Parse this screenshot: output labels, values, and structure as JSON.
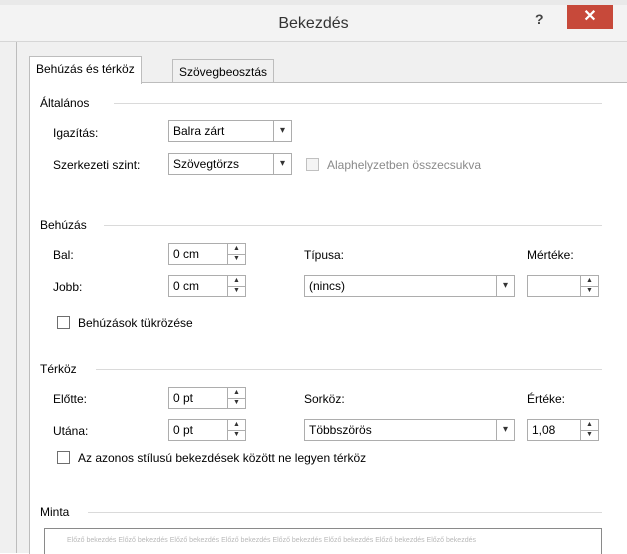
{
  "window": {
    "title": "Bekezdés",
    "help": "?",
    "close": "✕"
  },
  "tabs": [
    {
      "label": "Behúzás és térköz",
      "active": true
    },
    {
      "label": "Szövegbeosztás",
      "active": false
    }
  ],
  "general": {
    "legend": "Általános",
    "alignment_label": "Igazítás:",
    "alignment_value": "Balra zárt",
    "outline_label": "Szerkezeti szint:",
    "outline_value": "Szövegtörzs",
    "collapsed_label": "Alaphelyzetben összecsukva"
  },
  "indent": {
    "legend": "Behúzás",
    "left_label": "Bal:",
    "left_value": "0 cm",
    "right_label": "Jobb:",
    "right_value": "0 cm",
    "type_label": "Típusa:",
    "type_value": "(nincs)",
    "measure_label": "Mértéke:",
    "measure_value": "",
    "mirror_label": "Behúzások tükrözése"
  },
  "spacing": {
    "legend": "Térköz",
    "before_label": "Előtte:",
    "before_value": "0 pt",
    "after_label": "Utána:",
    "after_value": "0 pt",
    "line_label": "Sorköz:",
    "line_value": "Többszörös",
    "at_label": "Értéke:",
    "at_value": "1,08",
    "nospace_label": "Az azonos stílusú bekezdések között ne legyen térköz"
  },
  "preview": {
    "legend": "Minta",
    "text": "Előző bekezdés Előző bekezdés Előző bekezdés Előző bekezdés Előző bekezdés Előző bekezdés Előző bekezdés Előző bekezdés"
  }
}
